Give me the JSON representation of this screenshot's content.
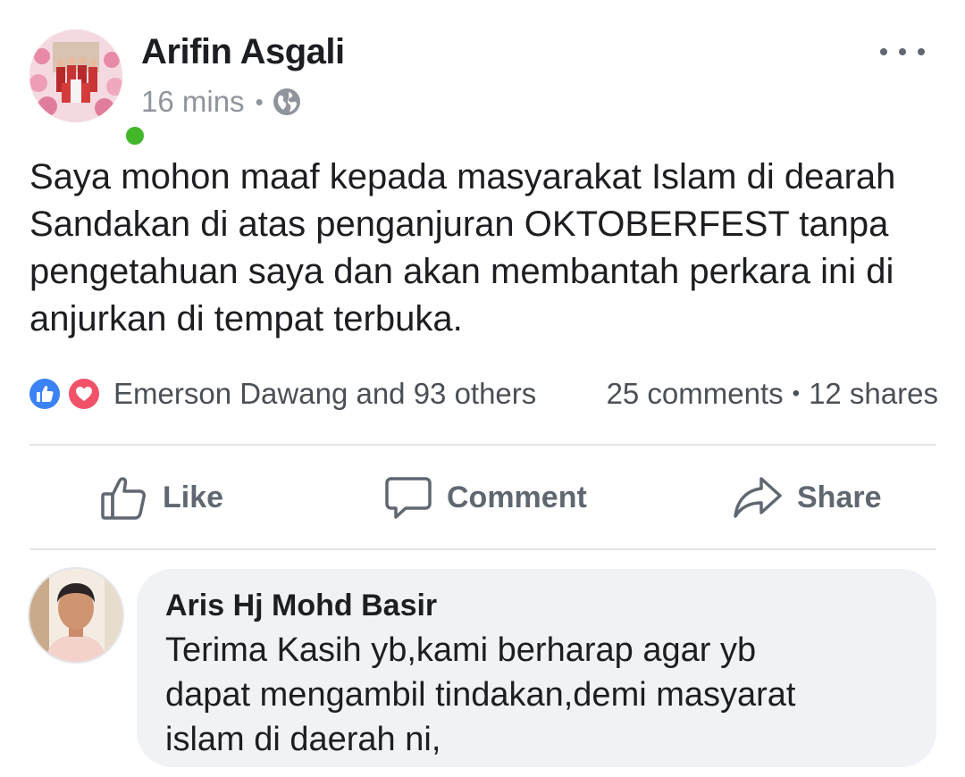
{
  "post": {
    "author": "Arifin Asgali",
    "time": "16 mins",
    "meta_separator": "•",
    "privacy_icon": "globe-icon",
    "text": "Saya mohon maaf kepada masyarakat Islam di dearah\nSandakan di atas penganjuran OKTOBERFEST tanpa\npengetahuan saya dan akan membantah perkara ini di\nanjurkan di tempat terbuka.",
    "online_status_color": "#42b72a"
  },
  "reactions": {
    "icons": [
      "like-reaction-icon",
      "love-reaction-icon"
    ],
    "summary": "Emerson Dawang and 93 others",
    "comments": "25 comments",
    "stats_separator": "•",
    "shares": "12 shares"
  },
  "actions": {
    "like_label": "Like",
    "comment_label": "Comment",
    "share_label": "Share"
  },
  "comment": {
    "author": "Aris Hj Mohd Basir",
    "text": "Terima Kasih yb,kami berharap agar yb\ndapat mengambil tindakan,demi masyarat\nislam di daerah ni,"
  },
  "colors": {
    "text_primary": "#1c1e21",
    "text_secondary": "#90949c",
    "action_gray": "#606770",
    "like_blue": "#3b82f6",
    "love_red": "#f25268",
    "comment_bubble": "#f0f2f5",
    "divider": "#e4e6eb"
  }
}
